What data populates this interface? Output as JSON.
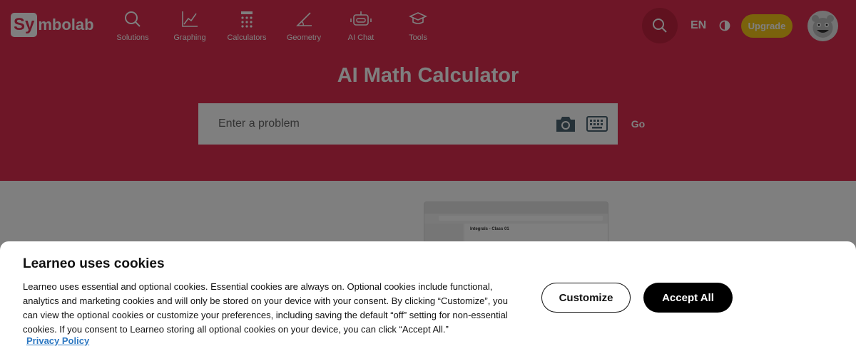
{
  "brand": {
    "logo_box": "Sy",
    "logo_rest": "mbolab"
  },
  "nav": {
    "items": [
      {
        "label": "Solutions",
        "icon": "search-icon"
      },
      {
        "label": "Graphing",
        "icon": "graph-icon"
      },
      {
        "label": "Calculators",
        "icon": "calculator-icon"
      },
      {
        "label": "Geometry",
        "icon": "angle-icon"
      },
      {
        "label": "AI Chat",
        "icon": "robot-icon"
      },
      {
        "label": "Tools",
        "icon": "graduation-cap-icon"
      }
    ],
    "language": "EN",
    "upgrade_label": "Upgrade"
  },
  "hero": {
    "title": "AI Math Calculator",
    "search_placeholder": "Enter a problem",
    "go_label": "Go"
  },
  "preview": {
    "title": "Integrals - Class 01"
  },
  "cookie": {
    "title": "Learneo uses cookies",
    "body": "Learneo uses essential and optional cookies. Essential cookies are always on. Optional cookies include functional, analytics and marketing cookies and will only be stored on your device with your consent. By clicking “Customize”, you can view the optional cookies or customize your preferences, including saving the default “off” setting for non-essential cookies. If you consent to Learneo storing all optional cookies on your device, you can click “Accept All.”",
    "privacy_label": "Privacy Policy",
    "customize_label": "Customize",
    "accept_label": "Accept All"
  },
  "colors": {
    "brand_red": "#dc2d4e",
    "upgrade_yellow": "#f5c518",
    "link_blue": "#2d78c2"
  }
}
